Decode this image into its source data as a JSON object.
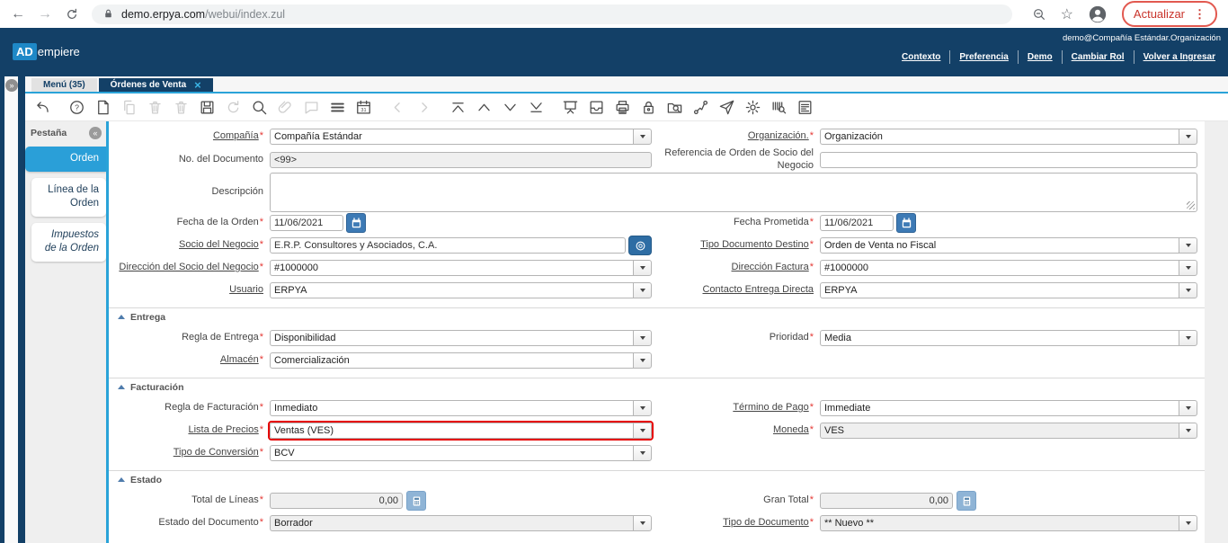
{
  "browser": {
    "host": "demo.erpya.com",
    "path": "/webui/index.zul",
    "update_button": "Actualizar"
  },
  "header": {
    "logo_primary": "AD",
    "logo_secondary": "empiere",
    "user_context": "demo@Compañía Estándar.Organización",
    "links": [
      "Contexto",
      "Preferencia",
      "Demo",
      "Cambiar Rol",
      "Volver a Ingresar"
    ]
  },
  "window_tabs": [
    {
      "label": "Menú (35)",
      "active": false,
      "closable": false
    },
    {
      "label": "Órdenes de Venta",
      "active": true,
      "closable": true
    }
  ],
  "left_rail_expand_icon": "»",
  "toolbar": [
    {
      "name": "undo",
      "enabled": true
    },
    {
      "name": "help",
      "enabled": true
    },
    {
      "name": "new-record",
      "enabled": true
    },
    {
      "name": "copy-record",
      "enabled": false
    },
    {
      "name": "delete-record",
      "enabled": false
    },
    {
      "name": "delete-selection",
      "enabled": false
    },
    {
      "name": "save",
      "enabled": true
    },
    {
      "name": "refresh",
      "enabled": false
    },
    {
      "name": "find",
      "enabled": true
    },
    {
      "name": "attachment",
      "enabled": false
    },
    {
      "name": "chat",
      "enabled": false
    },
    {
      "name": "grid-toggle",
      "enabled": true
    },
    {
      "name": "calendar",
      "enabled": true
    },
    {
      "name": "parent-record",
      "enabled": false
    },
    {
      "name": "detail-record",
      "enabled": false
    },
    {
      "name": "first-record",
      "enabled": true
    },
    {
      "name": "previous-record",
      "enabled": true
    },
    {
      "name": "next-record",
      "enabled": true
    },
    {
      "name": "last-record",
      "enabled": true
    },
    {
      "name": "report",
      "enabled": true
    },
    {
      "name": "archive",
      "enabled": true
    },
    {
      "name": "print",
      "enabled": true
    },
    {
      "name": "private-record-lock",
      "enabled": true
    },
    {
      "name": "zoom-across",
      "enabled": true
    },
    {
      "name": "workflow",
      "enabled": true
    },
    {
      "name": "request",
      "enabled": true
    },
    {
      "name": "preference",
      "enabled": true
    },
    {
      "name": "product-info",
      "enabled": true
    },
    {
      "name": "report-view",
      "enabled": true
    }
  ],
  "sidebar": {
    "title": "Pestaña",
    "collapse_icon": "«",
    "tabs": [
      {
        "label": "Orden",
        "active": true,
        "italic": false
      },
      {
        "label": "Línea de la Orden",
        "active": false,
        "italic": false
      },
      {
        "label": "Impuestos de la Orden",
        "active": false,
        "italic": true
      }
    ]
  },
  "form": {
    "sections": [
      {
        "title": "",
        "rows": [
          [
            {
              "label": "Compañía",
              "required": true,
              "link": true,
              "control": {
                "type": "select",
                "value": "Compañía Estándar"
              }
            },
            {
              "label": "Organización.",
              "required": true,
              "link": true,
              "control": {
                "type": "select",
                "value": "Organización"
              }
            }
          ],
          [
            {
              "label": "No. del Documento",
              "control": {
                "type": "text",
                "value": "<99>",
                "disabled": true
              }
            },
            {
              "label": "Referencia de Orden de Socio del Negocio",
              "control": {
                "type": "text",
                "value": ""
              }
            }
          ],
          [
            {
              "label": "Descripción",
              "full": true,
              "control": {
                "type": "textarea",
                "value": ""
              }
            }
          ],
          [
            {
              "label": "Fecha de la Orden",
              "required": true,
              "control": {
                "type": "date",
                "value": "11/06/2021"
              }
            },
            {
              "label": "Fecha Prometida",
              "required": true,
              "control": {
                "type": "date",
                "value": "11/06/2021"
              }
            }
          ],
          [
            {
              "label": "Socio del Negocio",
              "required": true,
              "link": true,
              "control": {
                "type": "search",
                "value": "E.R.P. Consultores y Asociados, C.A."
              }
            },
            {
              "label": "Tipo Documento Destino",
              "required": true,
              "link": true,
              "control": {
                "type": "select",
                "value": "Orden de Venta no Fiscal"
              }
            }
          ],
          [
            {
              "label": "Dirección del Socio del Negocio",
              "required": true,
              "link": true,
              "control": {
                "type": "select",
                "value": "#1000000"
              }
            },
            {
              "label": "Dirección Factura",
              "required": true,
              "link": true,
              "control": {
                "type": "select",
                "value": "#1000000"
              }
            }
          ],
          [
            {
              "label": "Usuario",
              "link": true,
              "control": {
                "type": "select",
                "value": "ERPYA"
              }
            },
            {
              "label": "Contacto Entrega Directa",
              "link": true,
              "control": {
                "type": "select",
                "value": "ERPYA"
              }
            }
          ]
        ]
      },
      {
        "title": "Entrega",
        "rows": [
          [
            {
              "label": "Regla de Entrega",
              "required": true,
              "control": {
                "type": "select",
                "value": "Disponibilidad"
              }
            },
            {
              "label": "Prioridad",
              "required": true,
              "control": {
                "type": "select",
                "value": "Media"
              }
            }
          ],
          [
            {
              "label": "Almacén",
              "required": true,
              "link": true,
              "control": {
                "type": "select",
                "value": "Comercialización"
              }
            },
            null
          ]
        ]
      },
      {
        "title": "Facturación",
        "rows": [
          [
            {
              "label": "Regla de Facturación",
              "required": true,
              "control": {
                "type": "select",
                "value": "Inmediato"
              }
            },
            {
              "label": "Término de Pago",
              "required": true,
              "link": true,
              "control": {
                "type": "select",
                "value": "Immediate"
              }
            }
          ],
          [
            {
              "label": "Lista de Precios",
              "required": true,
              "link": true,
              "control": {
                "type": "select",
                "value": "Ventas (VES)",
                "highlight": true
              }
            },
            {
              "label": "Moneda",
              "required": true,
              "link": true,
              "control": {
                "type": "select",
                "value": "VES",
                "disabled": true
              }
            }
          ],
          [
            {
              "label": "Tipo de Conversión",
              "required": true,
              "link": true,
              "control": {
                "type": "select",
                "value": "BCV"
              }
            },
            null
          ]
        ]
      },
      {
        "title": "Estado",
        "rows": [
          [
            {
              "label": "Total de Líneas",
              "required": true,
              "control": {
                "type": "amount",
                "value": "0,00",
                "disabled": true
              }
            },
            {
              "label": "Gran Total",
              "required": true,
              "control": {
                "type": "amount",
                "value": "0,00",
                "disabled": true
              }
            }
          ],
          [
            {
              "label": "Estado del Documento",
              "required": true,
              "control": {
                "type": "select",
                "value": "Borrador",
                "disabled": true
              }
            },
            {
              "label": "Tipo de Documento",
              "required": true,
              "link": true,
              "control": {
                "type": "select",
                "value": "** Nuevo **",
                "disabled": true
              }
            }
          ]
        ]
      }
    ]
  },
  "colors": {
    "header_navy": "#134067",
    "accent_teal": "#2aa3d8",
    "sidebar_active_blue": "#2a9fd8",
    "mandatory_red": "#e53935",
    "highlight_red": "#e60000",
    "update_red": "#c9342b"
  }
}
